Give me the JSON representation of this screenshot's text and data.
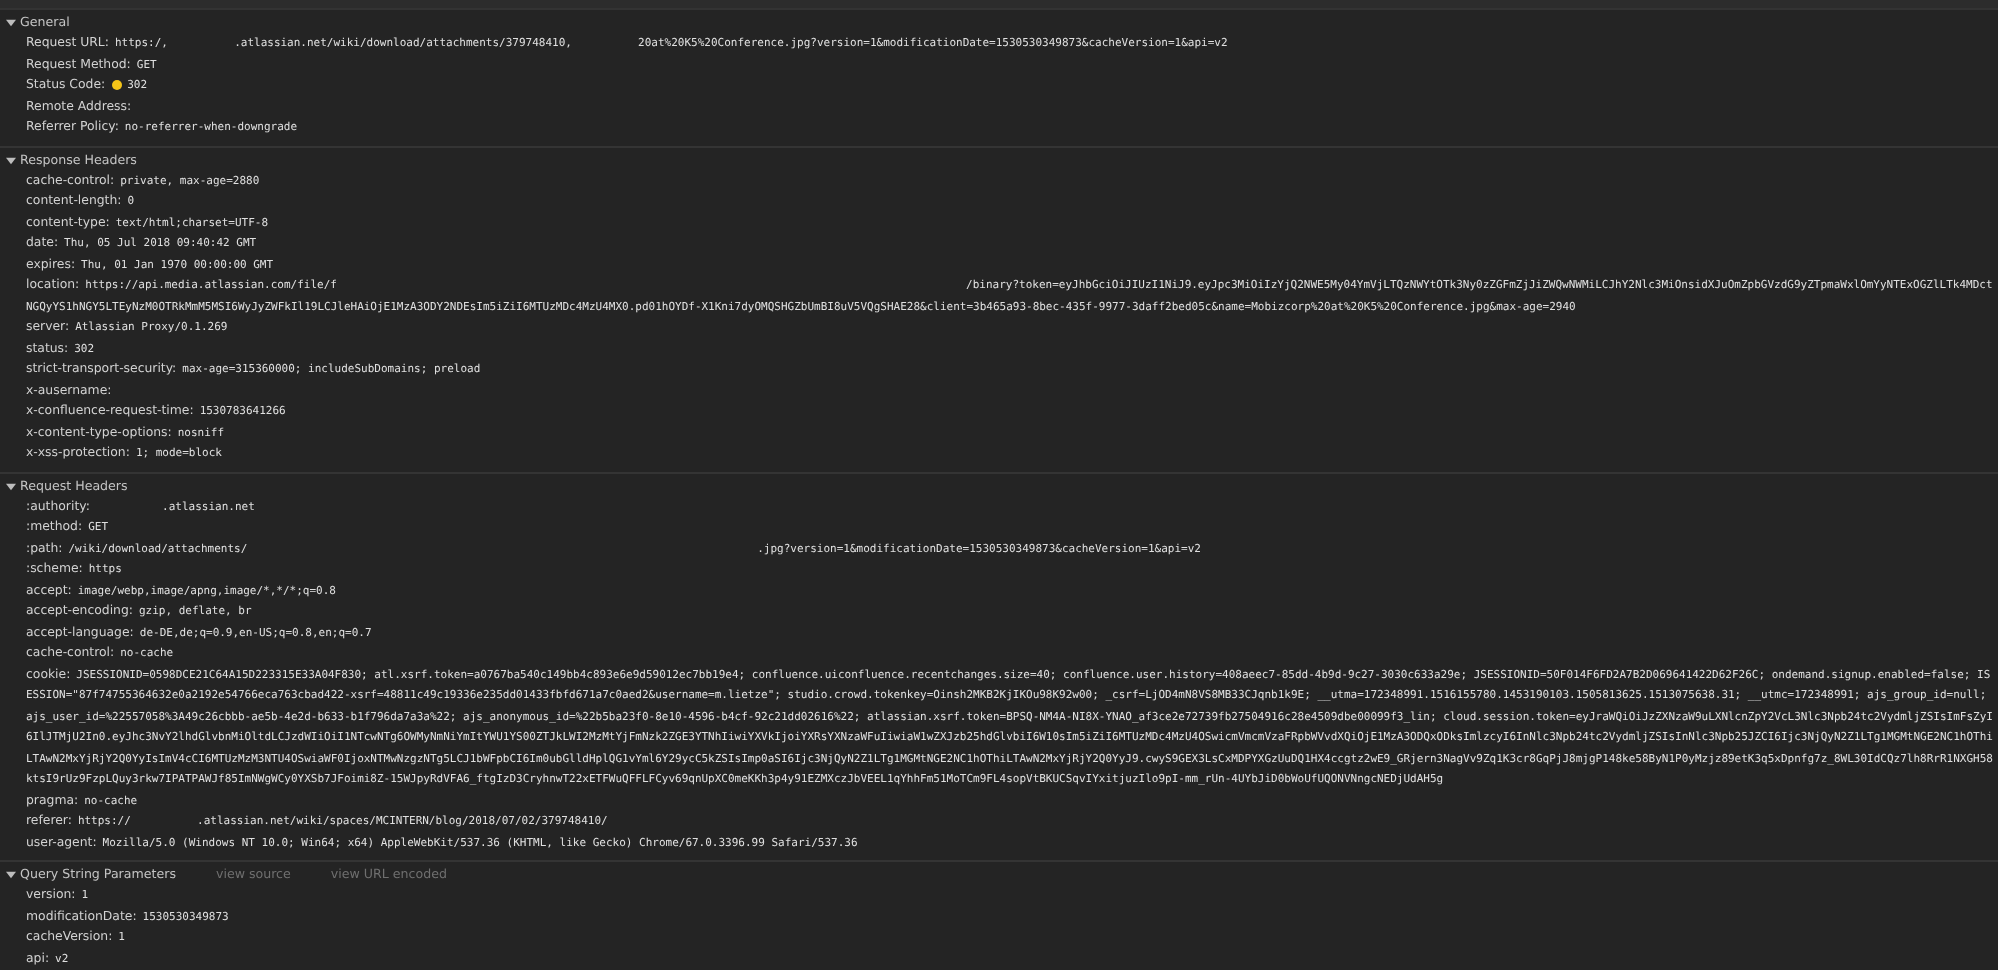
{
  "sections": [
    {
      "title": "General",
      "expanded": true,
      "rows": [
        {
          "name": "Request URL:",
          "value": "https:/,          .atlassian.net/wiki/download/attachments/379748410,          20at%20K5%20Conference.jpg?version=1&modificationDate=1530530349873&cacheVersion=1&api=v2"
        },
        {
          "name": "Request Method:",
          "value": "GET"
        },
        {
          "name": "Status Code:",
          "value": "302",
          "color": "#f5c518"
        },
        {
          "name": "Remote Address:"
        },
        {
          "name": "Referrer Policy:",
          "value": "no-referrer-when-downgrade"
        }
      ]
    },
    {
      "title": "Response Headers",
      "expanded": true,
      "rows": [
        {
          "name": "cache-control:",
          "value": "private, max-age=2880"
        },
        {
          "name": "content-length:",
          "value": "0"
        },
        {
          "name": "content-type:",
          "value": "text/html;charset=UTF-8"
        },
        {
          "name": "date:",
          "value": "Thu, 05 Jul 2018 09:40:42 GMT"
        },
        {
          "name": "expires:",
          "value": "Thu, 01 Jan 1970 00:00:00 GMT"
        },
        {
          "name": "location:",
          "value": "https://api.media.atlassian.com/file/f                                                                                               /binary?token=eyJhbGciOiJIUzI1NiJ9.eyJpc3MiOiIzYjQ2NWE5My04YmVjLTQzNWYtOTk3Ny0zZGFmZjJiZWQwNWMiLCJhY2Nlc3MiOnsidXJuOmZpbGVzdG9yZTpmaWxlOmYyNTExOGZlLTk4MDctNGQyYS1hNGY5LTEyNzM0OTRkMmM5MSI6WyJyZWFkIl19LCJleHAiOjE1MzA3ODY2NDEsIm5iZiI6MTUzMDc4MzU4MX0.pd01hOYDf-X1Kni7dyOMQSHGZbUmBI8uV5VQgSHAE28&client=3b465a93-8bec-435f-9977-3daff2bed05c&name=Mobizcorp%20at%20K5%20Conference.jpg&max-age=2940"
        },
        {
          "name": "server:",
          "value": "Atlassian Proxy/0.1.269"
        },
        {
          "name": "status:",
          "value": "302"
        },
        {
          "name": "strict-transport-security:",
          "value": "max-age=315360000; includeSubDomains; preload"
        },
        {
          "name": "x-ausername:"
        },
        {
          "name": "x-confluence-request-time:",
          "value": "1530783641266"
        },
        {
          "name": "x-content-type-options:",
          "value": "nosniff"
        },
        {
          "name": "x-xss-protection:",
          "value": "1; mode=block"
        }
      ]
    },
    {
      "title": "Request Headers",
      "expanded": true,
      "rows": [
        {
          "name": ":authority:",
          "value": "          .atlassian.net"
        },
        {
          "name": ":method:",
          "value": "GET"
        },
        {
          "name": ":path:",
          "value": "/wiki/download/attachments/                                                                             .jpg?version=1&modificationDate=1530530349873&cacheVersion=1&api=v2"
        },
        {
          "name": ":scheme:",
          "value": "https"
        },
        {
          "name": "accept:",
          "value": "image/webp,image/apng,image/*,*/*;q=0.8"
        },
        {
          "name": "accept-encoding:",
          "value": "gzip, deflate, br"
        },
        {
          "name": "accept-language:",
          "value": "de-DE,de;q=0.9,en-US;q=0.8,en;q=0.7"
        },
        {
          "name": "cache-control:",
          "value": "no-cache"
        },
        {
          "name": "cookie:",
          "value": "JSESSIONID=0598DCE21C64A15D223315E33A04F830; atl.xsrf.token=a0767ba540c149bb4c893e6e9d59012ec7bb19e4; confluence.uiconfluence.recentchanges.size=40; confluence.user.history=408aeec7-85dd-4b9d-9c27-3030c633a29e; JSESSIONID=50F014F6FD2A7B2D069641422D62F26C; ondemand.signup.enabled=false; ISESSION=\"87f74755364632e0a2192e54766eca763cbad422-xsrf=48811c49c19336e235dd01433fbfd671a7c0aed2&username=m.lietze\"; studio.crowd.tokenkey=Oinsh2MKB2KjIKOu98K92w00; _csrf=LjOD4mN8VS8MB33CJqnb1k9E; __utma=172348991.1516155780.1453190103.1505813625.1513075638.31; __utmc=172348991; ajs_group_id=null; ajs_user_id=%22557058%3A49c26cbbb-ae5b-4e2d-b633-b1f796da7a3a%22; ajs_anonymous_id=%22b5ba23f0-8e10-4596-b4cf-92c21dd02616%22; atlassian.xsrf.token=BPSQ-NM4A-NI8X-YNAO_af3ce2e72739fb27504916c28e4509dbe00099f3_lin; cloud.session.token=eyJraWQiOiJzZXNzaW9uLXNlcnZpY2VcL3Nlc3Npb24tc2VydmljZSIsImFsZyI6IlJTMjU2In0.eyJhc3NvY2lhdGlvbnMiOltdLCJzdWIiOiI1NTcwNTg6OWMyNmNiYmItYWU1YS00ZTJkLWI2MzMtYjFmNzk2ZGE3YTNhIiwiYXVkIjoiYXRsYXNzaWFuIiwiaW1wZXJzb25hdGlvbiI6W10sIm5iZiI6MTUzMDc4MzU4OSwicmVmcmVzaFRpbWVvdXQiOjE1MzA3ODQxODksImlzcyI6InNlc3Npb24tc2VydmljZSIsInNlc3Npb25JZCI6Ijc3NjQyN2Z1LTg1MGMtNGE2NC1hOThiLTAwN2MxYjRjY2Q0YyIsImV4cCI6MTUzMzM3NTU4OSwiaWF0IjoxNTMwNzgzNTg5LCJ1bWFpbCI6Im0ubGlldHplQG1vYml6Y29ycC5kZSIsImp0aSI6Ijc3NjQyN2Z1LTg1MGMtNGE2NC1hOThiLTAwN2MxYjRjY2Q0YyJ9.cwyS9GEX3LsCxMDPYXGzUuDQ1HX4ccgtz2wE9_GRjern3NagVv9Zq1K3cr8GqPjJ8mjgP148ke58ByN1P0yMzjz89etK3q5xDpnfg7z_8WL30IdCQz7lh8RrR1NXGH58ktsI9rUz9FzpLQuy3rkw7IPATPAWJf85ImNWgWCy0YXSb7JFoimi8Z-15WJpyRdVFA6_ftgIzD3CryhnwT22xETFWuQFFLFCyv69qnUpXC0meKKh3p4y91EZMXczJbVEEL1qYhhFm51MoTCm9FL4sopVtBKUCSqvIYxitjuzIlo9pI-mm_rUn-4UYbJiD0bWoUfUQONVNngcNEDjUdAH5g"
        },
        {
          "name": "pragma:",
          "value": "no-cache"
        },
        {
          "name": "referer:",
          "value": "https://          .atlassian.net/wiki/spaces/MCINTERN/blog/2018/07/02/379748410/"
        },
        {
          "name": "user-agent:",
          "value": "Mozilla/5.0 (Windows NT 10.0; Win64; x64) AppleWebKit/537.36 (KHTML, like Gecko) Chrome/67.0.3396.99 Safari/537.36"
        }
      ]
    },
    {
      "title": "Query String Parameters",
      "expanded": true,
      "links": [
        "view source",
        "view URL encoded"
      ],
      "rows": [
        {
          "name": "version:",
          "value": "1"
        },
        {
          "name": "modificationDate:",
          "value": "1530530349873"
        },
        {
          "name": "cacheVersion:",
          "value": "1"
        },
        {
          "name": "api:",
          "value": "v2"
        }
      ]
    }
  ]
}
